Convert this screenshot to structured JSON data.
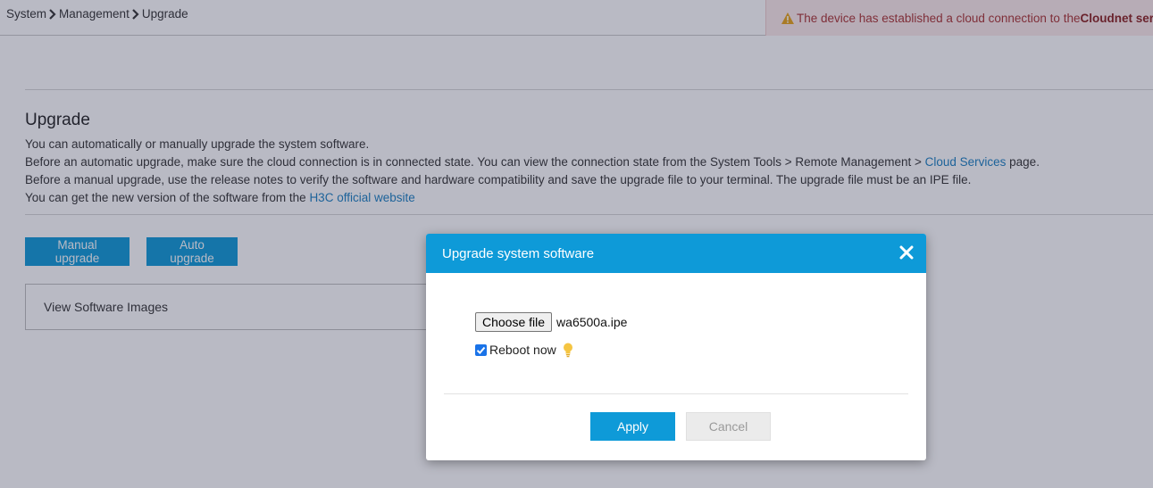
{
  "breadcrumb": {
    "items": [
      "System",
      "Management",
      "Upgrade"
    ]
  },
  "notice": {
    "text": "The device has established a cloud connection to the ",
    "bold": "Cloudnet server."
  },
  "page": {
    "title": "Upgrade",
    "line1": "You can automatically or manually upgrade the system software.",
    "line2_pre": "Before an automatic upgrade, make sure the cloud connection is in connected state. You can view the connection state from the System Tools > Remote Management > ",
    "line2_link": "Cloud Services",
    "line2_post": " page.",
    "line3": "Before a manual upgrade, use the release notes to verify the software and hardware compatibility and save the upgrade file to your terminal. The upgrade file must be an IPE file.",
    "line4_pre": "You can get the new version of the software from the ",
    "line4_link": "H3C official website"
  },
  "buttons": {
    "manual": "Manual upgrade",
    "auto": "Auto upgrade"
  },
  "images_box": {
    "label": "View Software Images"
  },
  "dialog": {
    "title": "Upgrade system software",
    "choose_file": "Choose file",
    "file_name": "wa6500a.ipe",
    "reboot_label": "Reboot now",
    "reboot_checked": true,
    "apply": "Apply",
    "cancel": "Cancel"
  },
  "colors": {
    "accent": "#0e9ad8",
    "link": "#1a7fc1",
    "notice_bg": "#fdeaea",
    "warning": "#e8a317",
    "bulb": "#f5c542"
  },
  "icons": [
    "chevron-right-icon",
    "warning-icon",
    "close-icon",
    "check-icon",
    "lightbulb-icon"
  ]
}
